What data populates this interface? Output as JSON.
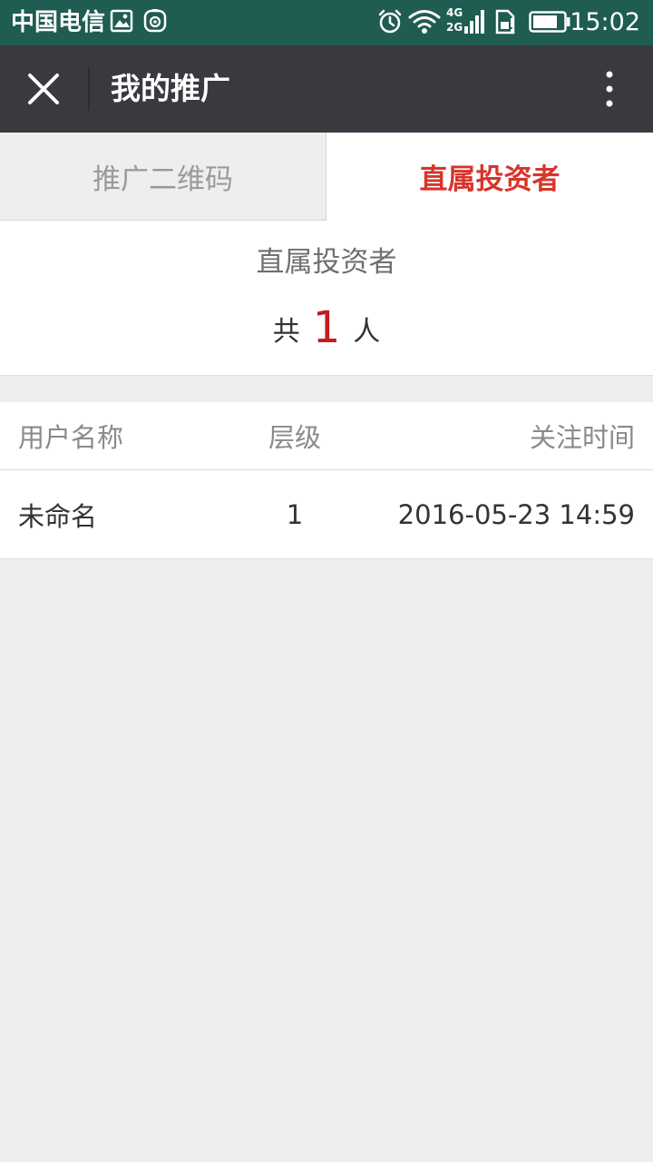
{
  "status_bar": {
    "carrier": "中国电信",
    "network_badge_top": "4G",
    "network_badge_bottom": "2G",
    "time": "15:02",
    "icons": [
      "image-icon",
      "camera-icon",
      "alarm-icon",
      "wifi-icon",
      "signal-icon",
      "sim-alert-icon",
      "battery-icon"
    ]
  },
  "nav": {
    "title": "我的推广",
    "close_icon": "close-icon",
    "more_icon": "more-vertical-icon"
  },
  "tabs": [
    {
      "label": "推广二维码",
      "active": false
    },
    {
      "label": "直属投资者",
      "active": true
    }
  ],
  "summary": {
    "title": "直属投资者",
    "prefix": "共",
    "count": "1",
    "suffix": "人"
  },
  "table": {
    "columns": [
      "用户名称",
      "层级",
      "关注时间"
    ],
    "rows": [
      {
        "name": "未命名",
        "level": "1",
        "time": "2016-05-23 14:59"
      }
    ]
  },
  "colors": {
    "status_bar": "#1f5c52",
    "nav_bar": "#393a3f",
    "accent": "#d6352c",
    "count": "#c51d1d",
    "background": "#ededed"
  }
}
